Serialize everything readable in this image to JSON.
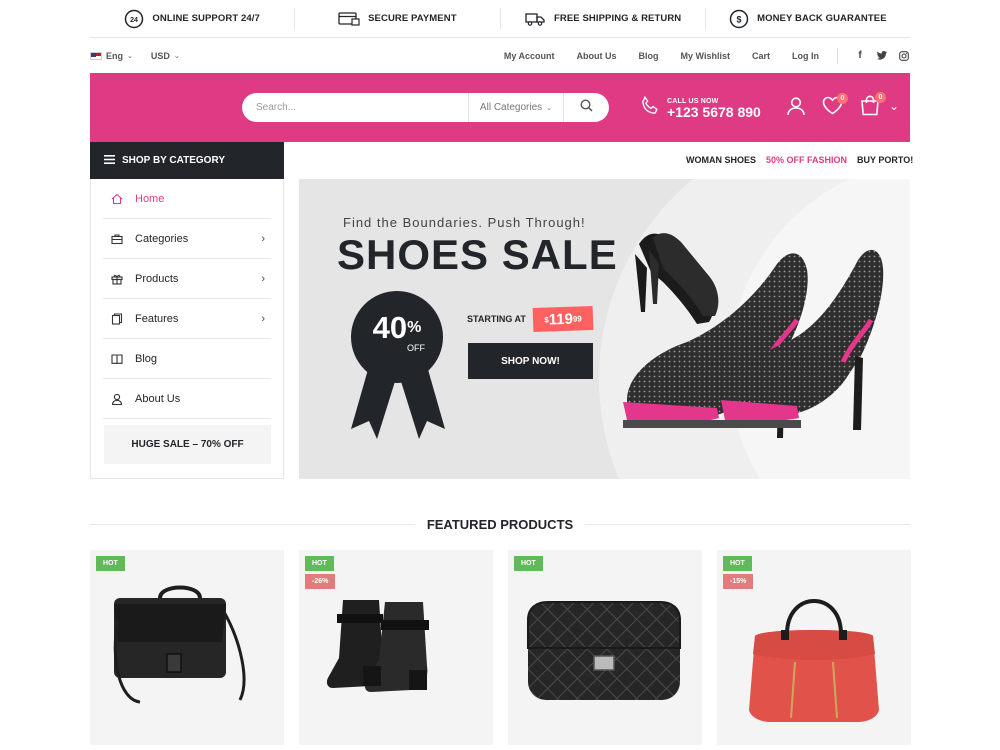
{
  "features": [
    {
      "label": "ONLINE SUPPORT 24/7",
      "icon": "support-24-icon"
    },
    {
      "label": "SECURE PAYMENT",
      "icon": "secure-payment-icon"
    },
    {
      "label": "FREE SHIPPING & RETURN",
      "icon": "shipping-truck-icon"
    },
    {
      "label": "MONEY BACK GUARANTEE",
      "icon": "money-back-icon"
    }
  ],
  "topbar": {
    "language": "Eng",
    "currency": "USD",
    "links": [
      "My Account",
      "About Us",
      "Blog",
      "My Wishlist",
      "Cart",
      "Log In"
    ],
    "social": [
      "f",
      "t",
      "ig"
    ]
  },
  "header": {
    "search_placeholder": "Search...",
    "category_select": "All Categories",
    "call_label": "CALL US NOW",
    "phone": "+123 5678 890",
    "wishlist_count": "0",
    "cart_count": "0",
    "brand_color": "#de3b84"
  },
  "sidebar": {
    "heading": "SHOP BY CATEGORY",
    "items": [
      {
        "label": "Home",
        "active": true
      },
      {
        "label": "Categories",
        "has_children": true
      },
      {
        "label": "Products",
        "has_children": true
      },
      {
        "label": "Features",
        "has_children": true
      },
      {
        "label": "Blog"
      },
      {
        "label": "About Us"
      }
    ],
    "promo": "HUGE SALE – 70% OFF"
  },
  "secondary_nav": [
    "WOMAN SHOES",
    "50% OFF FASHION",
    "BUY PORTO!"
  ],
  "banner": {
    "tagline": "Find the Boundaries. Push Through!",
    "title": "SHOES SALE",
    "discount": "40",
    "discount_pct": "%",
    "discount_off": "OFF",
    "starting_at": "STARTING AT",
    "price_currency": "$",
    "price_main": "119",
    "price_cents": "99",
    "cta": "SHOP NOW!"
  },
  "featured": {
    "heading": "FEATURED PRODUCTS",
    "products": [
      {
        "name": "black messenger bag",
        "labels": [
          "HOT"
        ]
      },
      {
        "name": "black ankle boots",
        "labels": [
          "HOT",
          "-26%"
        ]
      },
      {
        "name": "black quilted clutch",
        "labels": [
          "HOT"
        ]
      },
      {
        "name": "red handbag",
        "labels": [
          "HOT",
          "-15%"
        ]
      }
    ]
  }
}
